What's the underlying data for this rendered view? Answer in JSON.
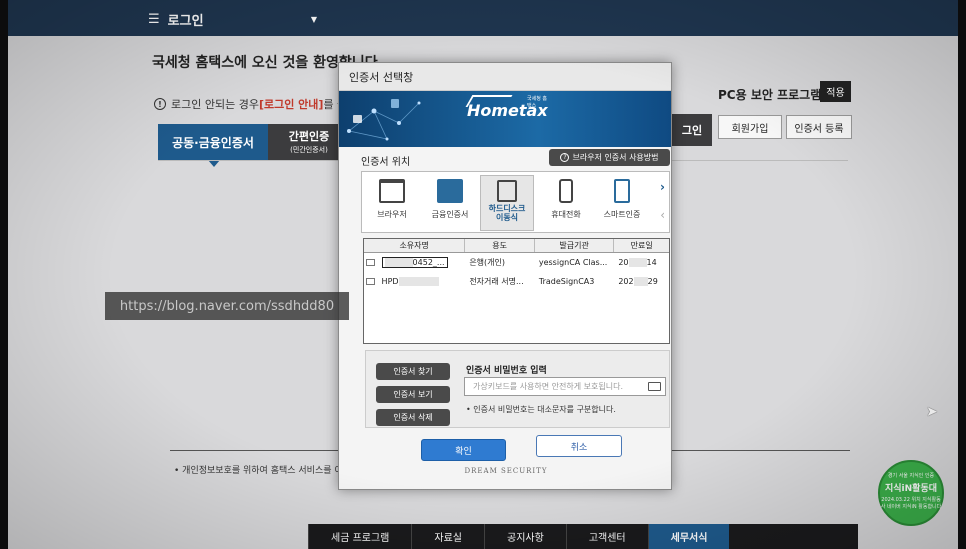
{
  "topbar": {
    "menu_label": "로그인",
    "menu_icon": "hamburger-icon",
    "caret_icon": "caret-down-icon"
  },
  "page": {
    "welcome": "국세청 홈택스에 오신 것을 환영합니다.",
    "notice_pre": "로그인 안되는 경우 ",
    "notice_link": "[로그인 안내]",
    "notice_post": "를 놀",
    "pc_security": "PC용 보안 프로그램",
    "apply": "적용",
    "tab_cert": "공동·금융인증서",
    "tab_simple": "간편인증",
    "tab_simple_sub": "(민간인증서)",
    "tab_right": "그인",
    "join": "회원가입",
    "cert_register": "인증서 등록",
    "privacy": "• 개인정보보호를 위하여 홈택스 서비스를 이",
    "bottom_menu": [
      "세금 프로그램",
      "자료실",
      "공지사항",
      "고객센터",
      "세무서식"
    ]
  },
  "watermark": "https://blog.naver.com/ssdhdd80",
  "badge": {
    "top": "경기 서울 지식인 인증",
    "title": "지식iN활동대",
    "bottom": "2024.03.22 위치 지식활동사 네이버 지식iN 활동합니다"
  },
  "dialog": {
    "title": "인증서 선택창",
    "logo": "Hometax",
    "logo_tag": "국세청 홈택스",
    "location_label": "인증서 위치",
    "guide_button": "브라우저 인증서 사용방법",
    "locations": [
      {
        "label": "브라우저",
        "icon": "browser-icon"
      },
      {
        "label": "금융인증서",
        "icon": "financial-cert-icon"
      },
      {
        "label": "하드디스크\n이동식",
        "icon": "harddisk-icon"
      },
      {
        "label": "휴대전화",
        "icon": "phone-icon"
      },
      {
        "label": "스마트인증",
        "icon": "smart-cert-icon"
      }
    ],
    "table": {
      "headers": [
        "소유자명",
        "용도",
        "발급기관",
        "만료일"
      ],
      "rows": [
        {
          "owner": "0452_...",
          "usage": "은행(개인)",
          "issuer": "yessignCA Clas...",
          "expiry_pre": "20",
          "expiry_post": "14"
        },
        {
          "owner": "HPD",
          "usage": "전자거래 서명...",
          "issuer": "TradeSignCA3",
          "expiry_pre": "202",
          "expiry_post": "29"
        }
      ]
    },
    "btn_find": "인증서 찾기",
    "btn_view": "인증서 보기",
    "btn_delete": "인증서 삭제",
    "pw_label": "인증서 비밀번호 입력",
    "pw_placeholder": "가상키보드를 사용하면 안전하게 보호됩니다.",
    "pw_note": "• 인증서 비밀번호는 대소문자를 구분합니다.",
    "ok": "확인",
    "cancel": "취소",
    "vendor": "DREAM SECURITY"
  }
}
